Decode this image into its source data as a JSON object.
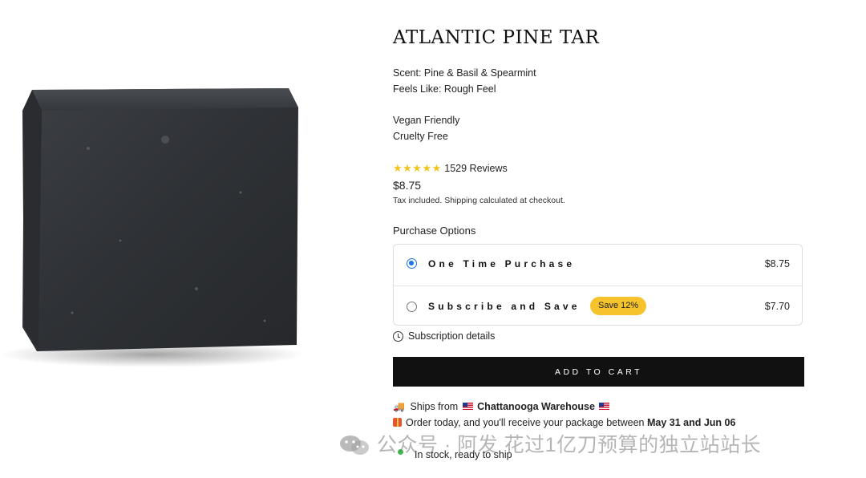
{
  "product": {
    "title": "ATLANTIC PINE TAR",
    "scent": "Scent: Pine & Basil & Spearmint",
    "feels_like": "Feels Like: Rough Feel",
    "attributes": [
      "Vegan Friendly",
      "Cruelty Free"
    ],
    "rating_stars": 5,
    "reviews_text": "1529 Reviews",
    "price": "$8.75",
    "tax_note": "Tax included. Shipping calculated at checkout."
  },
  "purchase": {
    "title": "Purchase Options",
    "options": [
      {
        "label": "One Time Purchase",
        "price": "$8.75",
        "selected": true
      },
      {
        "label": "Subscribe and Save",
        "price": "$7.70",
        "badge": "Save 12%",
        "selected": false
      }
    ],
    "subscription_details": "Subscription details",
    "add_to_cart": "ADD TO CART"
  },
  "shipping": {
    "ships_from_prefix": "Ships from",
    "warehouse": "Chattanooga Warehouse",
    "order_prefix": "Order today, and you'll receive your package between",
    "delivery_window": "May 31 and Jun 06",
    "stock_text": "In stock, ready to ship"
  },
  "watermark": {
    "text": "公众号 · 阿发 花过1亿刀预算的独立站站长"
  },
  "colors": {
    "accent_radio": "#1a73e8",
    "badge": "#f6c32c",
    "stars": "#f4c31c",
    "button": "#111111",
    "stock_dot": "#3bbd48"
  }
}
